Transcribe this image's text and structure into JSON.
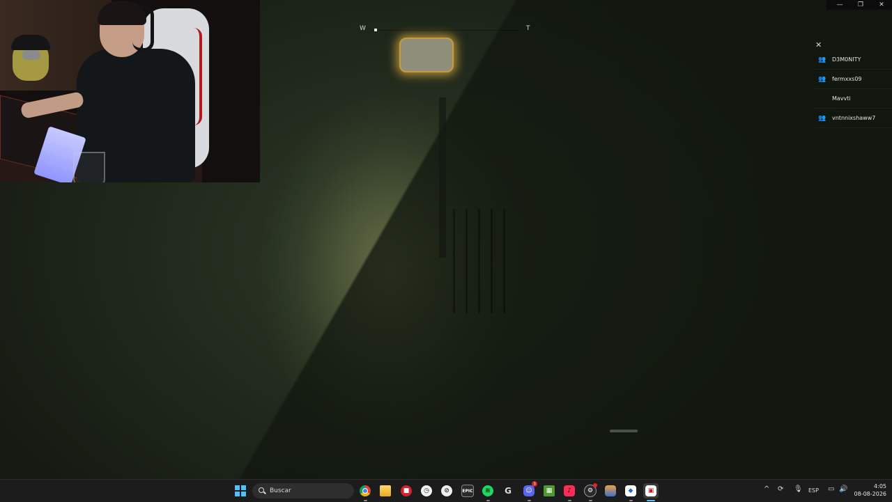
{
  "window": {
    "minimize_glyph": "—",
    "restore_glyph": "❐",
    "close_glyph": "✕"
  },
  "compass": {
    "left_label": "W",
    "right_label": "T"
  },
  "player_list": {
    "close_glyph": "✕",
    "players": [
      {
        "name": "D3M0NITY",
        "icon": "friends-icon",
        "icon_glyph": "👥"
      },
      {
        "name": "fermxxs09",
        "icon": "friends-icon",
        "icon_glyph": "👥"
      },
      {
        "name": "Mavvti",
        "icon": "",
        "icon_glyph": ""
      },
      {
        "name": "vntnnixshaww7",
        "icon": "friends-icon",
        "icon_glyph": "👥"
      }
    ]
  },
  "taskbar": {
    "search_placeholder": "Buscar",
    "apps": [
      {
        "name": "chrome-icon",
        "glyph": ""
      },
      {
        "name": "file-explorer-icon",
        "glyph": ""
      },
      {
        "name": "red-app-icon",
        "glyph": "■"
      },
      {
        "name": "clock-app-icon",
        "glyph": "◷"
      },
      {
        "name": "compass-app-icon",
        "glyph": "⊘"
      },
      {
        "name": "epic-games-icon",
        "glyph": "EPIC"
      },
      {
        "name": "spotify-icon",
        "glyph": "≋"
      },
      {
        "name": "g-app-icon",
        "glyph": "G"
      },
      {
        "name": "discord-icon",
        "glyph": "☺",
        "badge": "3"
      },
      {
        "name": "minecraft-icon",
        "glyph": "▦"
      },
      {
        "name": "tiktok-icon",
        "glyph": "♪"
      },
      {
        "name": "steam-icon",
        "glyph": "⚙"
      },
      {
        "name": "fortnite-icon",
        "glyph": ""
      },
      {
        "name": "roblox-icon",
        "glyph": "◆"
      },
      {
        "name": "roblox-studio-icon",
        "glyph": "▣"
      }
    ],
    "tray": {
      "chevron": "^",
      "sync": "⟳",
      "mic": "🎙",
      "language": "ESP",
      "display": "▭",
      "volume": "🔊",
      "time": "4:05",
      "date": "08-08-2026"
    }
  },
  "colors": {
    "taskbar_accent": "#4cc2ff",
    "lamp_glow": "#d6a83e"
  }
}
